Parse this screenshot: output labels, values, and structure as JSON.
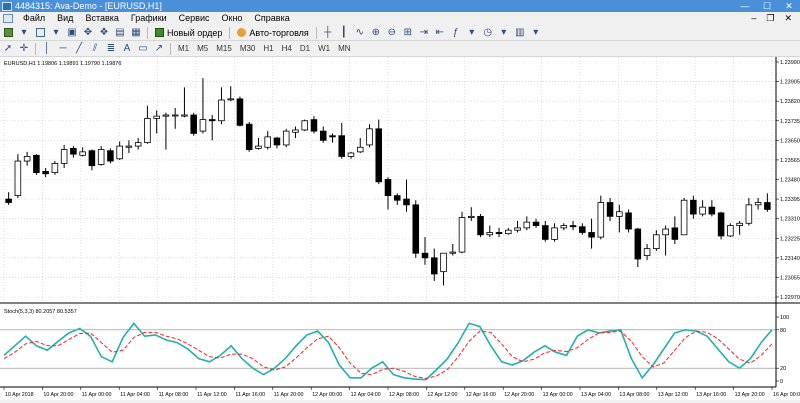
{
  "window": {
    "title": "4484315: Ava-Demo - [EURUSD,H1]",
    "minimize": "—",
    "maximize": "☐",
    "close": "✕"
  },
  "menu": {
    "items": [
      "Файл",
      "Вид",
      "Вставка",
      "Графики",
      "Сервис",
      "Окно",
      "Справка"
    ],
    "doc_controls": [
      "–",
      "❐",
      "✕"
    ]
  },
  "toolbar": {
    "new_order": "Новый ордер",
    "auto_trading": "Авто-торговля",
    "timeframes": [
      "M1",
      "M5",
      "M15",
      "M30",
      "H1",
      "H4",
      "D1",
      "W1",
      "MN"
    ]
  },
  "colors": {
    "accent": "#4a90d9",
    "candle": "#000000",
    "stoch_main": "#20b2aa",
    "stoch_signal": "#ff2020",
    "grid": "#c8c8c8"
  },
  "chart_data": [
    {
      "type": "candlestick",
      "title": "EURUSD,H1  1.19806 1.19891 1.19790 1.19876",
      "yticks": [
        "1.23990",
        "1.23905",
        "1.23820",
        "1.23735",
        "1.23650",
        "1.23565",
        "1.23480",
        "1.23395",
        "1.23310",
        "1.23225",
        "1.23140",
        "1.23055",
        "1.22970"
      ],
      "ylim": [
        1.2297,
        1.2399
      ],
      "ohlc": [
        [
          1.23395,
          1.23425,
          1.2337,
          1.2338
        ],
        [
          1.2341,
          1.2359,
          1.234,
          1.2356
        ],
        [
          1.2356,
          1.236,
          1.2354,
          1.2358
        ],
        [
          1.23585,
          1.2359,
          1.235,
          1.2351
        ],
        [
          1.23515,
          1.2353,
          1.2349,
          1.23505
        ],
        [
          1.2351,
          1.2356,
          1.235,
          1.2355
        ],
        [
          1.2355,
          1.2363,
          1.2353,
          1.2361
        ],
        [
          1.23615,
          1.23625,
          1.23575,
          1.2359
        ],
        [
          1.23585,
          1.2362,
          1.2358,
          1.236
        ],
        [
          1.23605,
          1.2361,
          1.2352,
          1.2354
        ],
        [
          1.23545,
          1.23625,
          1.2354,
          1.2361
        ],
        [
          1.23605,
          1.23615,
          1.2355,
          1.2356
        ],
        [
          1.2357,
          1.23645,
          1.23565,
          1.23625
        ],
        [
          1.2362,
          1.2365,
          1.23595,
          1.23625
        ],
        [
          1.23625,
          1.2366,
          1.2361,
          1.2364
        ],
        [
          1.2364,
          1.238,
          1.23635,
          1.23745
        ],
        [
          1.23745,
          1.2378,
          1.2368,
          1.23755
        ],
        [
          1.23755,
          1.2377,
          1.2361,
          1.2376
        ],
        [
          1.2376,
          1.2379,
          1.237,
          1.2376
        ],
        [
          1.23755,
          1.2388,
          1.2375,
          1.2376
        ],
        [
          1.2376,
          1.2377,
          1.2367,
          1.2368
        ],
        [
          1.2369,
          1.2392,
          1.2368,
          1.2374
        ],
        [
          1.2374,
          1.2376,
          1.2365,
          1.23735
        ],
        [
          1.23735,
          1.2388,
          1.2372,
          1.23825
        ],
        [
          1.2383,
          1.23885,
          1.2382,
          1.2383
        ],
        [
          1.2383,
          1.2384,
          1.2371,
          1.23715
        ],
        [
          1.2372,
          1.2373,
          1.236,
          1.2361
        ],
        [
          1.23615,
          1.2366,
          1.2361,
          1.23625
        ],
        [
          1.2362,
          1.2369,
          1.2361,
          1.23665
        ],
        [
          1.2366,
          1.23665,
          1.23615,
          1.2363
        ],
        [
          1.2363,
          1.237,
          1.2362,
          1.2369
        ],
        [
          1.23685,
          1.2371,
          1.2366,
          1.23695
        ],
        [
          1.23695,
          1.2374,
          1.2369,
          1.23735
        ],
        [
          1.2374,
          1.23755,
          1.2368,
          1.2369
        ],
        [
          1.2369,
          1.2371,
          1.2364,
          1.2365
        ],
        [
          1.2367,
          1.2368,
          1.2364,
          1.23665
        ],
        [
          1.2367,
          1.23725,
          1.2357,
          1.2358
        ],
        [
          1.2358,
          1.236,
          1.2357,
          1.23595
        ],
        [
          1.236,
          1.2366,
          1.23595,
          1.2362
        ],
        [
          1.2363,
          1.2372,
          1.2362,
          1.237
        ],
        [
          1.237,
          1.2374,
          1.2346,
          1.2347
        ],
        [
          1.2348,
          1.2349,
          1.2335,
          1.2341
        ],
        [
          1.2341,
          1.2342,
          1.2337,
          1.2339
        ],
        [
          1.23395,
          1.2348,
          1.2334,
          1.2337
        ],
        [
          1.2337,
          1.2339,
          1.2314,
          1.2316
        ],
        [
          1.2316,
          1.2323,
          1.2311,
          1.2314
        ],
        [
          1.2314,
          1.2318,
          1.2304,
          1.2307
        ],
        [
          1.2308,
          1.2316,
          1.2302,
          1.2316
        ],
        [
          1.2316,
          1.232,
          1.2315,
          1.23165
        ],
        [
          1.23165,
          1.2334,
          1.2316,
          1.23315
        ],
        [
          1.23315,
          1.2336,
          1.233,
          1.2332
        ],
        [
          1.2332,
          1.2333,
          1.2323,
          1.2324
        ],
        [
          1.2324,
          1.2328,
          1.2323,
          1.2325
        ],
        [
          1.2325,
          1.2327,
          1.2323,
          1.23245
        ],
        [
          1.23245,
          1.2327,
          1.2324,
          1.2326
        ],
        [
          1.2326,
          1.233,
          1.2325,
          1.2327
        ],
        [
          1.2327,
          1.2332,
          1.2326,
          1.23295
        ],
        [
          1.23295,
          1.2331,
          1.2327,
          1.2328
        ],
        [
          1.2328,
          1.233,
          1.2321,
          1.2322
        ],
        [
          1.2322,
          1.2329,
          1.2321,
          1.2327
        ],
        [
          1.2327,
          1.2329,
          1.2326,
          1.2328
        ],
        [
          1.2328,
          1.233,
          1.2326,
          1.23275
        ],
        [
          1.23275,
          1.2329,
          1.2324,
          1.2325
        ],
        [
          1.2325,
          1.2331,
          1.2318,
          1.2323
        ],
        [
          1.2323,
          1.2341,
          1.2322,
          1.2338
        ],
        [
          1.2338,
          1.234,
          1.233,
          1.2332
        ],
        [
          1.2332,
          1.2337,
          1.2325,
          1.2334
        ],
        [
          1.23335,
          1.2335,
          1.2325,
          1.23265
        ],
        [
          1.23265,
          1.2327,
          1.231,
          1.23135
        ],
        [
          1.2315,
          1.232,
          1.2313,
          1.2318
        ],
        [
          1.2318,
          1.2326,
          1.2317,
          1.2324
        ],
        [
          1.2324,
          1.2328,
          1.2315,
          1.23265
        ],
        [
          1.2327,
          1.2332,
          1.232,
          1.2322
        ],
        [
          1.2324,
          1.234,
          1.2324,
          1.2339
        ],
        [
          1.2339,
          1.2341,
          1.2331,
          1.2333
        ],
        [
          1.2333,
          1.2339,
          1.2332,
          1.2336
        ],
        [
          1.2336,
          1.2339,
          1.2332,
          1.2333
        ],
        [
          1.23335,
          1.2334,
          1.2322,
          1.23235
        ],
        [
          1.23235,
          1.2329,
          1.2323,
          1.2328
        ],
        [
          1.2328,
          1.233,
          1.2324,
          1.2329
        ],
        [
          1.2329,
          1.234,
          1.2328,
          1.2337
        ],
        [
          1.2337,
          1.234,
          1.2335,
          1.2338
        ],
        [
          1.2338,
          1.2342,
          1.2334,
          1.2335
        ]
      ]
    },
    {
      "type": "line",
      "title": "Stoch(5,3,3) 80.2057 80.5357",
      "yticks": [
        "100",
        "80",
        "20",
        "0"
      ],
      "ylim": [
        0,
        100
      ],
      "levels": [
        80,
        20
      ],
      "series": [
        {
          "name": "Main",
          "values": [
            40,
            55,
            70,
            55,
            48,
            62,
            75,
            82,
            70,
            38,
            30,
            68,
            90,
            70,
            72,
            64,
            60,
            50,
            35,
            30,
            40,
            55,
            35,
            20,
            10,
            20,
            35,
            55,
            72,
            78,
            60,
            25,
            5,
            5,
            20,
            30,
            10,
            5,
            3,
            2,
            18,
            35,
            60,
            90,
            85,
            55,
            30,
            25,
            32,
            45,
            55,
            45,
            40,
            70,
            80,
            75,
            78,
            80,
            35,
            5,
            25,
            50,
            75,
            80,
            78,
            70,
            50,
            30,
            20,
            35,
            60,
            80
          ]
        },
        {
          "name": "Signal",
          "values": [
            35,
            45,
            58,
            62,
            55,
            55,
            65,
            74,
            75,
            60,
            45,
            48,
            68,
            76,
            76,
            70,
            66,
            58,
            48,
            38,
            36,
            42,
            42,
            35,
            22,
            17,
            22,
            36,
            52,
            66,
            70,
            52,
            28,
            12,
            10,
            18,
            20,
            15,
            7,
            4,
            8,
            18,
            38,
            62,
            78,
            76,
            58,
            38,
            30,
            34,
            44,
            48,
            46,
            52,
            65,
            75,
            76,
            78,
            62,
            38,
            22,
            28,
            48,
            68,
            78,
            76,
            66,
            50,
            34,
            28,
            40,
            58
          ]
        }
      ]
    }
  ],
  "time_axis": [
    "10 Apr 2018",
    "10 Apr 20:00",
    "11 Apr 00:00",
    "11 Apr 04:00",
    "11 Apr 08:00",
    "11 Apr 12:00",
    "11 Apr 16:00",
    "11 Apr 20:00",
    "12 Apr 00:00",
    "12 Apr 04:00",
    "12 Apr 08:00",
    "12 Apr 12:00",
    "12 Apr 16:00",
    "12 Apr 20:00",
    "13 Apr 00:00",
    "13 Apr 04:00",
    "13 Apr 08:00",
    "13 Apr 12:00",
    "13 Apr 16:00",
    "13 Apr 20:00",
    "16 Apr 00:00"
  ]
}
